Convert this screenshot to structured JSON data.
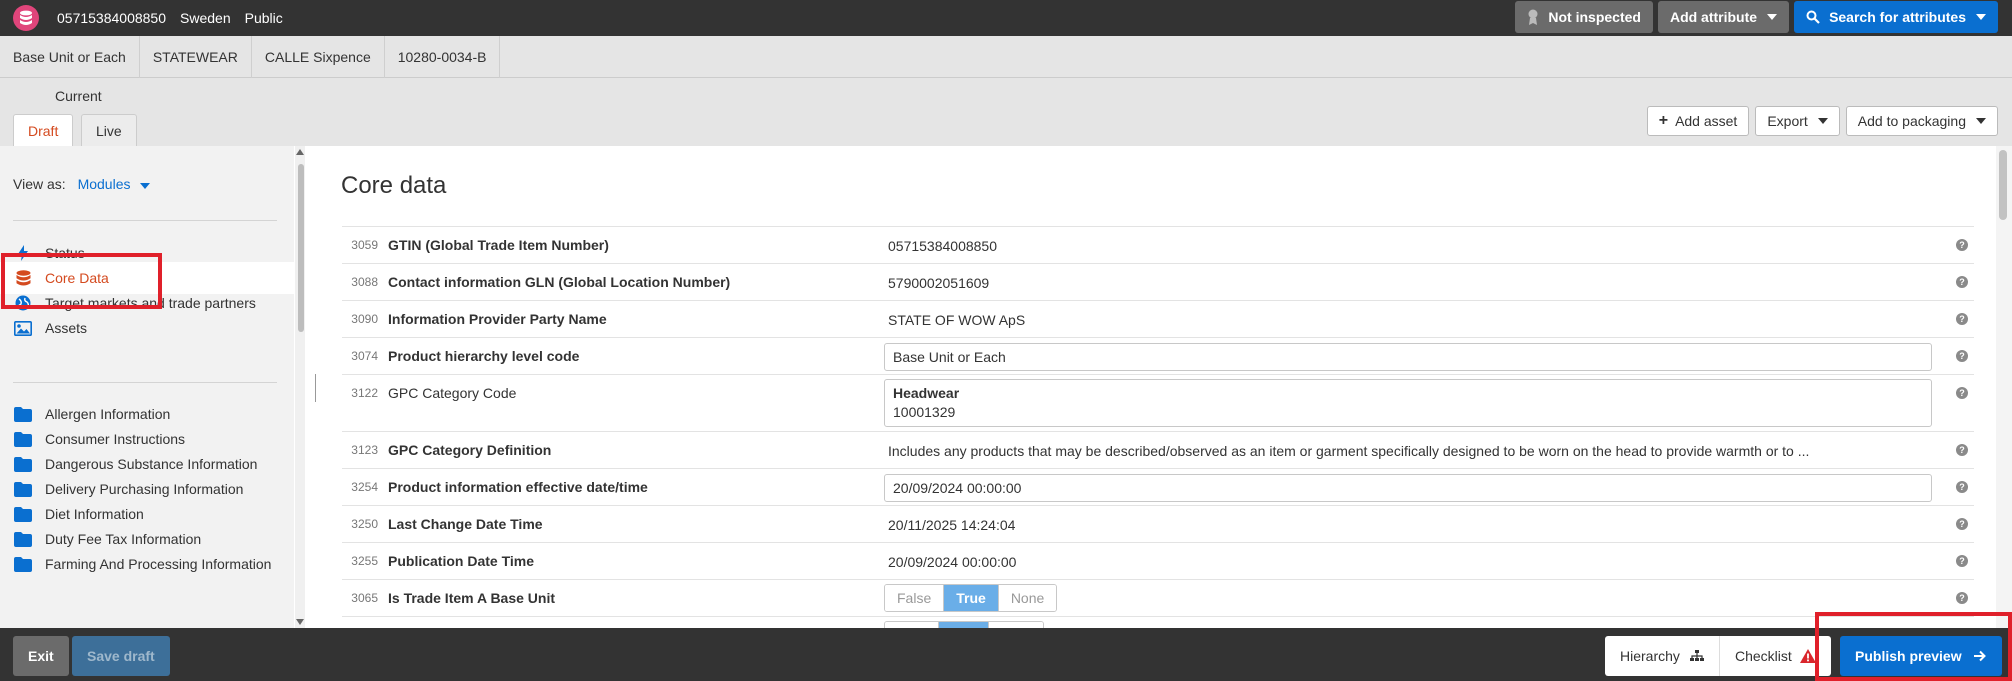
{
  "topbar": {
    "item_id": "05715384008850",
    "country": "Sweden",
    "visibility": "Public",
    "not_inspected": "Not inspected",
    "add_attribute": "Add attribute",
    "search_attributes": "Search for attributes"
  },
  "breadcrumb": [
    "Base Unit or Each",
    "STATEWEAR",
    "CALLE Sixpence",
    "10280-0034-B"
  ],
  "tabs": {
    "current_label": "Current",
    "draft": "Draft",
    "live": "Live"
  },
  "actions": {
    "add_asset": "Add asset",
    "export": "Export",
    "add_to_packaging": "Add to packaging"
  },
  "sidebar": {
    "view_as_label": "View as:",
    "view_as_value": "Modules",
    "primary": [
      "Status",
      "Core Data",
      "Target markets and trade partners",
      "Assets"
    ],
    "modules": [
      "Allergen Information",
      "Consumer Instructions",
      "Dangerous Substance Information",
      "Delivery Purchasing Information",
      "Diet Information",
      "Duty Fee Tax Information",
      "Farming And Processing Information"
    ]
  },
  "main": {
    "title": "Core data",
    "rows": [
      {
        "code": "3059",
        "label": "GTIN (Global Trade Item Number)",
        "value": "05715384008850"
      },
      {
        "code": "3088",
        "label": "Contact information GLN (Global Location Number)",
        "value": "5790002051609"
      },
      {
        "code": "3090",
        "label": "Information Provider Party Name",
        "value": "STATE OF WOW ApS"
      },
      {
        "code": "3074",
        "label": "Product hierarchy level code",
        "value": "Base Unit or Each"
      },
      {
        "code": "3122",
        "label": "GPC Category Code",
        "value": "Headwear",
        "value2": "10001329"
      },
      {
        "code": "3123",
        "label": "GPC Category Definition",
        "value": "Includes any products that may be described/observed as an item or garment specifically designed to be worn on the head to provide warmth or to ..."
      },
      {
        "code": "3254",
        "label": "Product information effective date/time",
        "value": "20/09/2024 00:00:00"
      },
      {
        "code": "3250",
        "label": "Last Change Date Time",
        "value": "20/11/2025 14:24:04"
      },
      {
        "code": "3255",
        "label": "Publication Date Time",
        "value": "20/09/2024 00:00:00"
      },
      {
        "code": "3065",
        "label": "Is Trade Item A Base Unit",
        "options": [
          "False",
          "True",
          "None"
        ],
        "selected": "True"
      }
    ],
    "help_glyph": "?"
  },
  "bottombar": {
    "exit": "Exit",
    "save_draft": "Save draft",
    "hierarchy": "Hierarchy",
    "checklist": "Checklist",
    "publish_preview": "Publish preview"
  },
  "colors": {
    "accent_blue": "#0a6fd0",
    "active_orange": "#d44a1f",
    "highlight_red": "#e0202a",
    "dark_bar": "#333333"
  }
}
